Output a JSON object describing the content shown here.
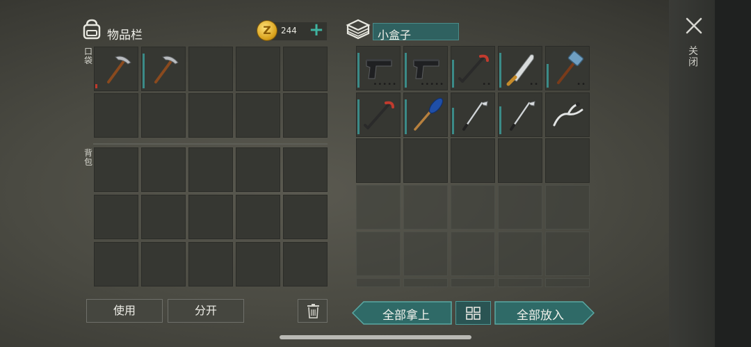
{
  "inventory": {
    "title": "物品栏",
    "coins": "244",
    "coin_symbol": "Z",
    "plus_label": "+",
    "pockets_label": "口袋",
    "backpack_label": "背包",
    "pocket_slots": [
      {
        "icon": "pickaxe-icon",
        "durability_low": true
      },
      {
        "icon": "pickaxe-icon",
        "durability_low": false
      },
      {
        "icon": null
      },
      {
        "icon": null
      },
      {
        "icon": null
      },
      {
        "icon": null
      },
      {
        "icon": null
      },
      {
        "icon": null
      },
      {
        "icon": null
      },
      {
        "icon": null
      }
    ],
    "backpack_rows": 3,
    "backpack_cols": 5
  },
  "container": {
    "name": "小盒子",
    "slots": [
      {
        "icon": "pistol-icon"
      },
      {
        "icon": "pistol-icon"
      },
      {
        "icon": "crowbar-icon"
      },
      {
        "icon": "machete-icon"
      },
      {
        "icon": "sledgehammer-icon"
      },
      {
        "icon": "crowbar-icon"
      },
      {
        "icon": "oar-icon"
      },
      {
        "icon": "golf-club-icon"
      },
      {
        "icon": "golf-club-icon"
      },
      {
        "icon": "handlebar-icon"
      }
    ]
  },
  "buttons": {
    "use": "使用",
    "split": "分开",
    "take_all": "全部拿上",
    "put_all": "全部放入"
  },
  "close_label": "关闭",
  "colors": {
    "accent_teal": "#3b8b88",
    "coin_gold": "#d9a21c"
  }
}
